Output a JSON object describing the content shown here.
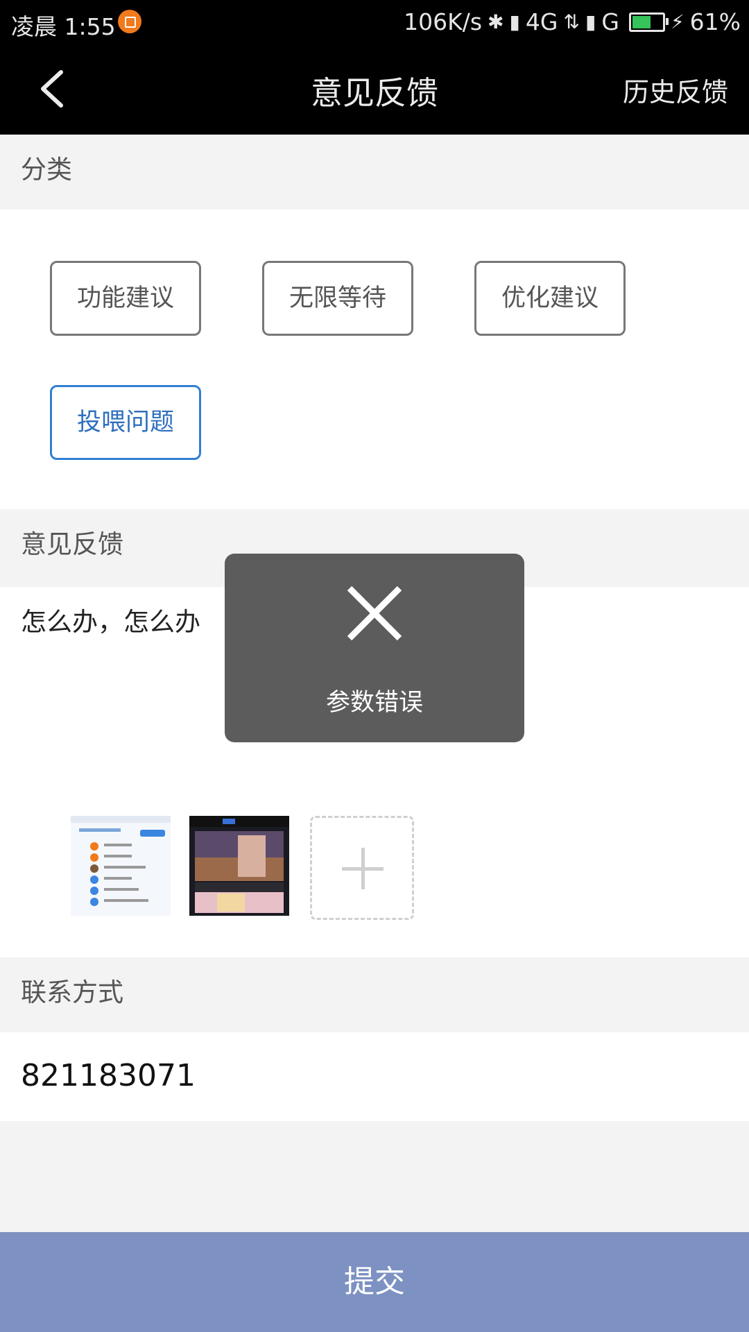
{
  "status_bar": {
    "time": "凌晨 1:55",
    "network_speed": "106K/s",
    "signal_1": "4G",
    "signal_2": "G",
    "battery_percent": "61%",
    "battery_level": 0.61,
    "battery_color": "#35c35a"
  },
  "nav": {
    "back_icon": "chevron-left-icon",
    "title": "意见反馈",
    "history_label": "历史反馈"
  },
  "category": {
    "header": "分类",
    "options": [
      {
        "label": "功能建议",
        "selected": false
      },
      {
        "label": "无限等待",
        "selected": false
      },
      {
        "label": "优化建议",
        "selected": false
      },
      {
        "label": "投喂问题",
        "selected": true
      }
    ],
    "selected_color": "#2f7fd4"
  },
  "feedback": {
    "header": "意见反馈",
    "text": "怎么办，怎么办"
  },
  "attachments": {
    "add_icon": "plus-icon"
  },
  "contact": {
    "header": "联系方式",
    "value": "821183071"
  },
  "submit_label": "提交",
  "toast": {
    "icon": "close-icon",
    "message": "参数错误"
  },
  "colors": {
    "nav_background": "#000000",
    "submit_background": "#7d92c2",
    "page_background": "#f3f3f3"
  }
}
